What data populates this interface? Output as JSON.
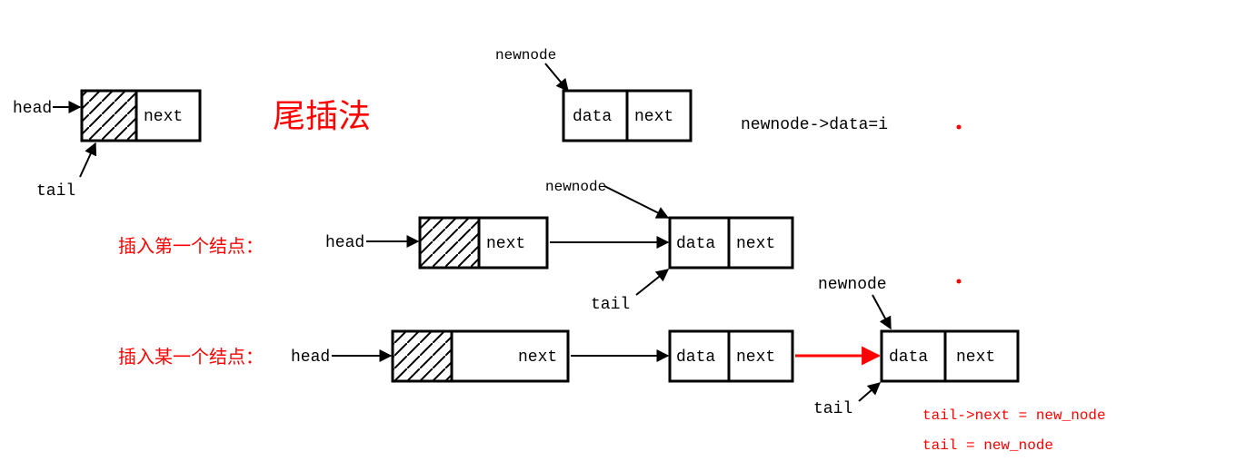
{
  "title": "尾插法",
  "labels": {
    "head": "head",
    "tail": "tail",
    "data": "data",
    "next": "next",
    "newnode": "newnode"
  },
  "captions": {
    "insert_first": "插入第一个结点：",
    "insert_some": "插入某一个结点："
  },
  "code": {
    "assign_data": "newnode->data=i",
    "tail_next": "tail->next = new_node",
    "tail_assign": "tail = new_node"
  }
}
